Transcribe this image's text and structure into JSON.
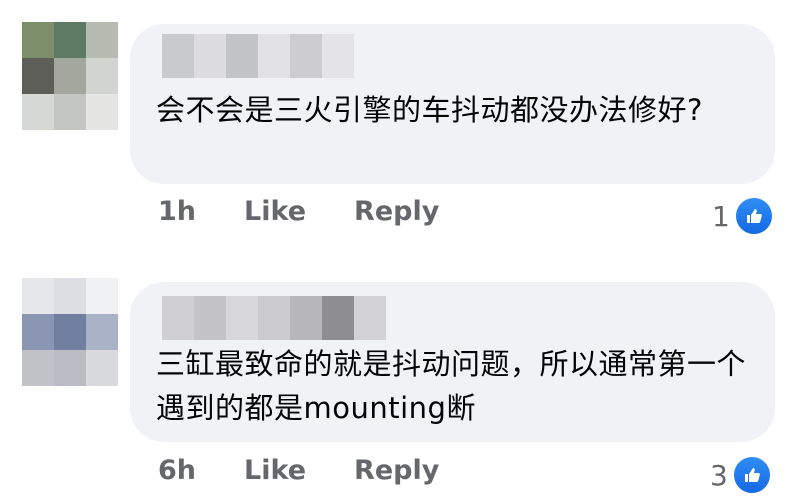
{
  "comments": [
    {
      "text": "会不会是三火引擎的车抖动都没办法修好?",
      "time": "1h",
      "like_label": "Like",
      "reply_label": "Reply",
      "reaction_count": "1"
    },
    {
      "text": "三缸最致命的就是抖动问题，所以通常第一个遇到的都是mounting断",
      "time": "6h",
      "like_label": "Like",
      "reply_label": "Reply",
      "reaction_count": "3"
    }
  ],
  "colors": {
    "bubble": "#f0f2f5",
    "meta_text": "#65676b",
    "like_blue": "#1877f2"
  },
  "icons": [
    "like-reaction-icon"
  ]
}
